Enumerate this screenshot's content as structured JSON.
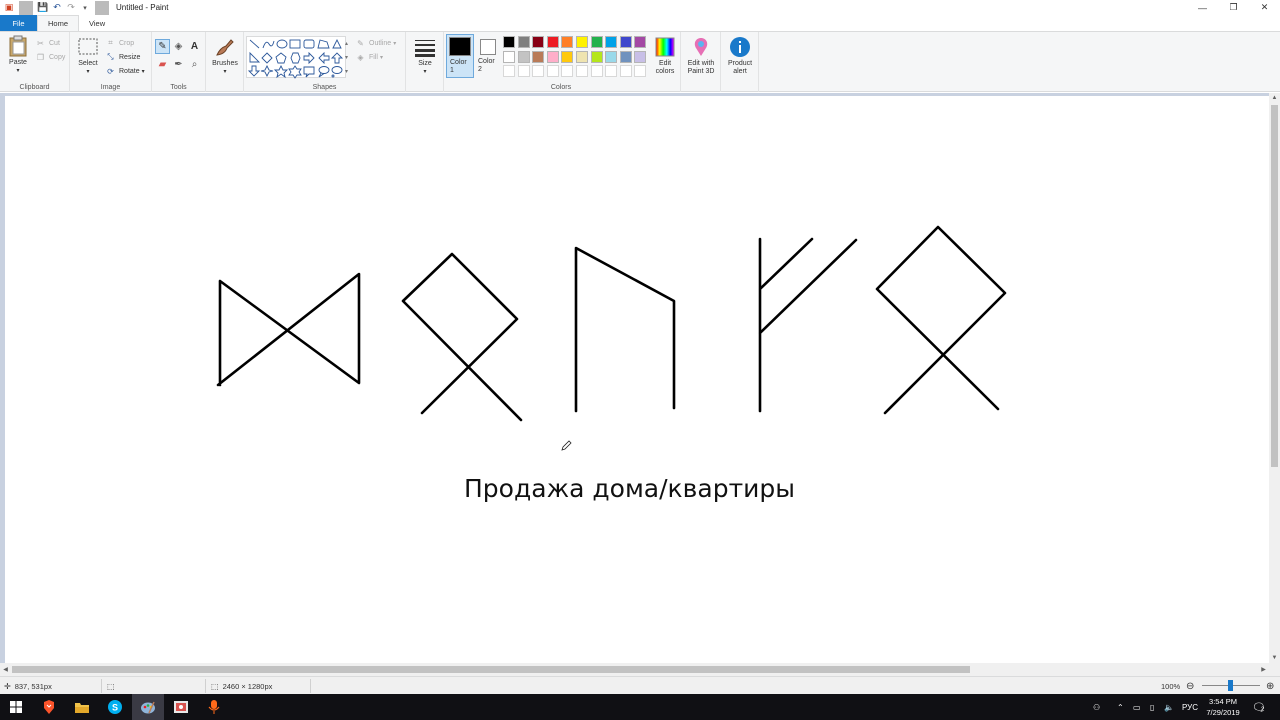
{
  "window": {
    "title": "Untitled - Paint",
    "minimize_glyph": "—",
    "maximize_glyph": "❐",
    "close_glyph": "✕"
  },
  "tabs": [
    {
      "label": "File"
    },
    {
      "label": "Home"
    },
    {
      "label": "View"
    }
  ],
  "ribbon": {
    "clipboard": {
      "label": "Clipboard",
      "paste": "Paste",
      "cut": "Cut",
      "copy": "Copy"
    },
    "image": {
      "label": "Image",
      "select": "Select",
      "crop": "Crop",
      "resize": "Resize",
      "rotate": "Rotate"
    },
    "tools": {
      "label": "Tools",
      "text_glyph": "A"
    },
    "brushes": {
      "label": "Brushes"
    },
    "shapes": {
      "label": "Shapes",
      "outline": "Outline",
      "fill": "Fill"
    },
    "size": {
      "label": "Size"
    },
    "colors": {
      "label": "Colors",
      "color1": "Color 1",
      "color2": "Color 2",
      "edit_colors": "Edit colors",
      "color1_value": "#000000",
      "color2_value": "#ffffff",
      "palette_row1": [
        "#000000",
        "#7f7f7f",
        "#880015",
        "#ed1c24",
        "#ff7f27",
        "#fff200",
        "#22b14c",
        "#00a2e8",
        "#3f48cc",
        "#a349a4"
      ],
      "palette_row2": [
        "#ffffff",
        "#c3c3c3",
        "#b97a57",
        "#ffaec9",
        "#ffc90e",
        "#efe4b0",
        "#b5e61d",
        "#99d9ea",
        "#7092be",
        "#c8bfe7"
      ],
      "palette_row3": [
        "#ffffff",
        "#ffffff",
        "#ffffff",
        "#ffffff",
        "#ffffff",
        "#ffffff",
        "#ffffff",
        "#ffffff",
        "#ffffff",
        "#ffffff"
      ]
    },
    "paint3d": "Edit with Paint 3D",
    "product_alert": "Product alert"
  },
  "canvas": {
    "text": "Продажа дома/квартиры"
  },
  "status": {
    "cursor_position": "837, 531px",
    "canvas_size": "2460 × 1280px",
    "zoom": "100%"
  },
  "taskbar": {
    "language": "РУС",
    "time": "3:54 PM",
    "date": "7/29/2019",
    "notification_count": "2"
  }
}
